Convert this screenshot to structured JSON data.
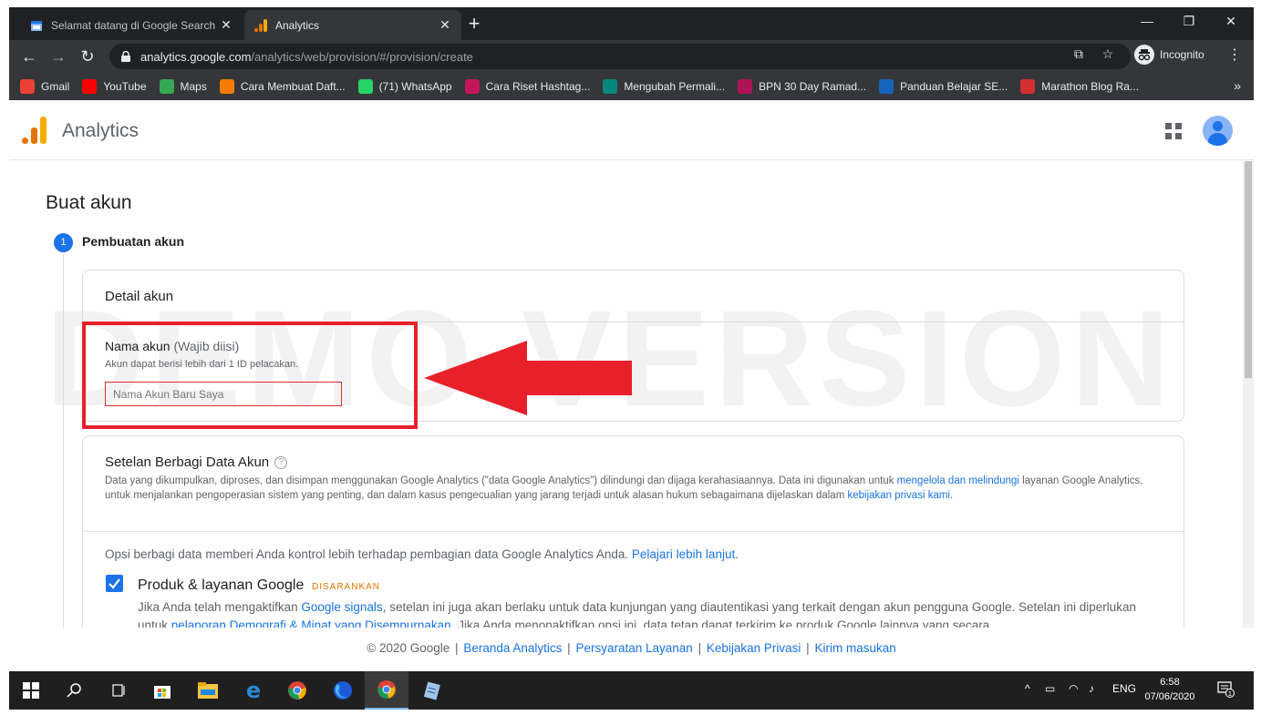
{
  "browser": {
    "tabs": [
      {
        "title": "Selamat datang di Google Search"
      },
      {
        "title": "Analytics"
      }
    ],
    "url_host": "analytics.google.com",
    "url_path": "/analytics/web/provision/#/provision/create",
    "profile_label": "Incognito"
  },
  "bookmarks": [
    {
      "label": "Gmail",
      "color": "#ea4335"
    },
    {
      "label": "YouTube",
      "color": "#ff0000"
    },
    {
      "label": "Maps",
      "color": "#34a853"
    },
    {
      "label": "Cara Membuat Daft...",
      "color": "#f57c00"
    },
    {
      "label": "(71) WhatsApp",
      "color": "#25d366"
    },
    {
      "label": "Cara Riset Hashtag...",
      "color": "#c2185b"
    },
    {
      "label": "Mengubah Permali...",
      "color": "#00897b"
    },
    {
      "label": "BPN 30 Day Ramad...",
      "color": "#ad1457"
    },
    {
      "label": "Panduan Belajar SE...",
      "color": "#1565c0"
    },
    {
      "label": "Marathon Blog Ra...",
      "color": "#d32f2f"
    }
  ],
  "app": {
    "title": "Analytics"
  },
  "page": {
    "heading": "Buat akun",
    "watermark": "DEMO VERSION",
    "step_number": "1",
    "step_label": "Pembuatan akun",
    "account_details": {
      "heading": "Detail akun",
      "field_label": "Nama akun",
      "field_required": "(Wajib diisi)",
      "field_help": "Akun dapat berisi lebih dari 1 ID pelacakan.",
      "field_placeholder": "Nama Akun Baru Saya"
    },
    "sharing": {
      "heading": "Setelan Berbagi Data Akun",
      "desc_part1": "Data yang dikumpulkan, diproses, dan disimpan menggunakan Google Analytics (\"data Google Analytics\") dilindungi dan dijaga kerahasiaannya. Data ini digunakan untuk ",
      "desc_link1": "mengelola dan melindungi",
      "desc_part2": " layanan Google Analytics, untuk menjalankan pengoperasian sistem yang penting, dan dalam kasus pengecualian yang jarang terjadi untuk alasan hukum sebagaimana dijelaskan dalam ",
      "desc_link2": "kebijakan privasi kami",
      "desc_part3": ".",
      "options_text": "Opsi berbagi data memberi Anda kontrol lebih terhadap pembagian data Google Analytics Anda. ",
      "options_link": "Pelajari lebih lanjut",
      "options_end": ".",
      "option1_title": "Produk & layanan Google",
      "option1_badge": "DISARANKAN",
      "option1_desc_part1": "Jika Anda telah mengaktifkan ",
      "option1_desc_link1": "Google signals",
      "option1_desc_part2": ", setelan ini juga akan berlaku untuk data kunjungan yang diautentikasi yang terkait dengan akun pengguna Google. Setelan ini diperlukan untuk ",
      "option1_desc_link2": "pelaporan Demografi & Minat yang Disempurnakan",
      "option1_desc_part3": ". Jika Anda menonaktifkan opsi ini, data tetap dapat terkirim ke produk Google lainnya yang secara"
    }
  },
  "footer": {
    "copyright": "© 2020 Google",
    "links": [
      "Beranda Analytics",
      "Persyaratan Layanan",
      "Kebijakan Privasi",
      "Kirim masukan"
    ]
  },
  "taskbar": {
    "language": "ENG",
    "time": "6:58",
    "date": "07/06/2020",
    "notification_count": "1"
  }
}
